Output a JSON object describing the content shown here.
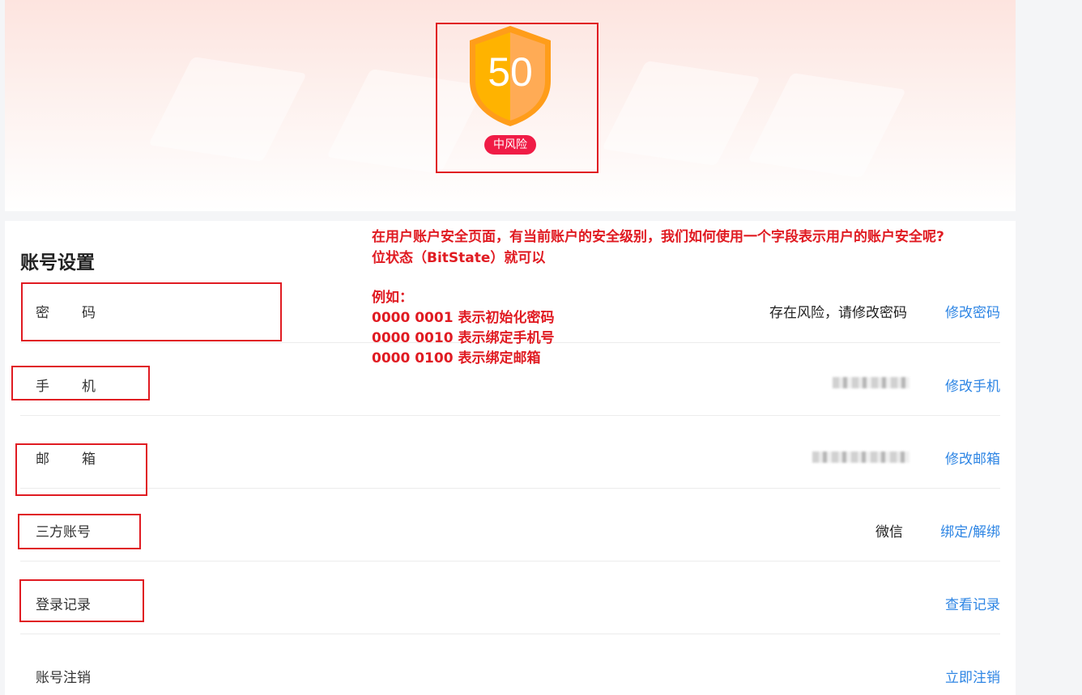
{
  "header": {
    "score": "50",
    "risk_level": "中风险",
    "colors": {
      "shield_left": "#ffb300",
      "shield_right": "#ffa34a",
      "risk_badge": "#f01c46"
    }
  },
  "account": {
    "title": "账号设置",
    "rows": [
      {
        "label": "密　　码",
        "value": "存在风险，请修改密码",
        "action": "修改密码"
      },
      {
        "label": "手　　机",
        "value": "",
        "action": "修改手机"
      },
      {
        "label": "邮　　箱",
        "value": "",
        "action": "修改邮箱"
      },
      {
        "label": "三方账号",
        "value": "微信",
        "action": "绑定/解绑"
      },
      {
        "label": "登录记录",
        "value": "",
        "action": "查看记录"
      },
      {
        "label": "账号注销",
        "value": "",
        "action": "立即注销"
      }
    ]
  },
  "annotation": {
    "line1": "在用户账户安全页面，有当前账户的安全级别，我们如何使用一个字段表示用户的账户安全呢?",
    "line2": "位状态（BitState）就可以",
    "line3": "例如：",
    "line4": "0000 0001 表示初始化密码",
    "line5": "0000 0010 表示绑定手机号",
    "line6": "0000 0100 表示绑定邮箱",
    "color": "#e01b22"
  },
  "icons": {
    "shield": "shield-icon"
  }
}
